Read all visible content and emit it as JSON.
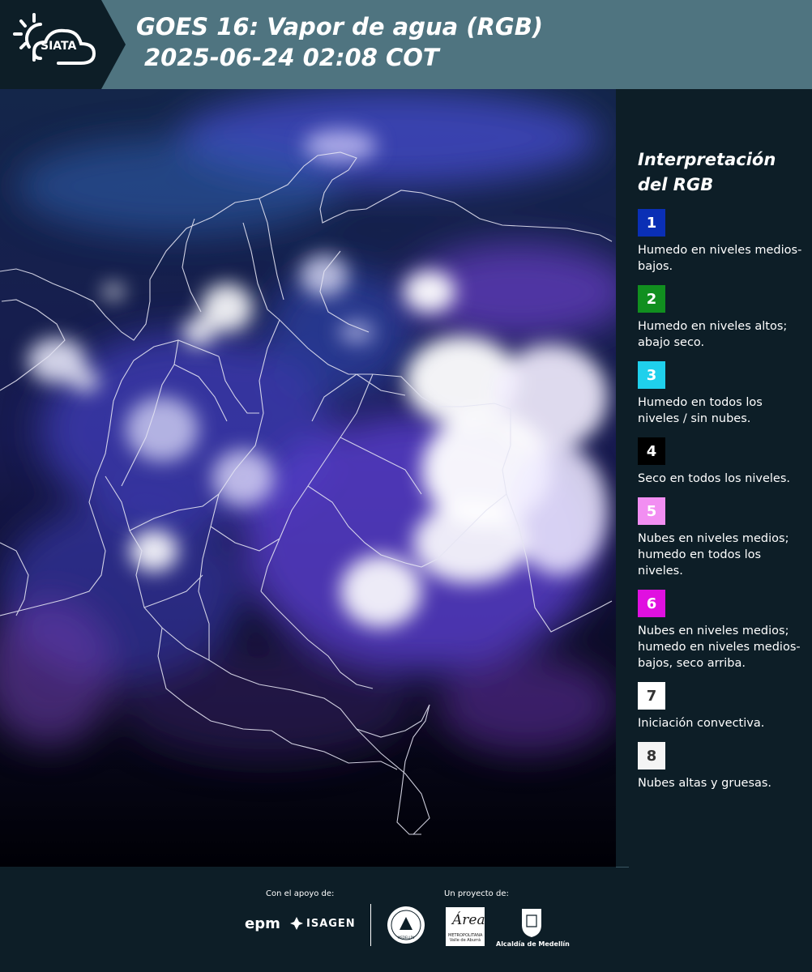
{
  "header": {
    "logo_text": "SIATA",
    "title_line1": "GOES 16: Vapor de agua (RGB)",
    "title_line2": "2025-06-24 02:08 COT"
  },
  "legend": {
    "title_line1": "Interpretación",
    "title_line2": "del RGB",
    "items": [
      {
        "number": "1",
        "color": "#0a2fb5",
        "text_color": "#ffffff",
        "label": "Humedo en niveles medios-bajos."
      },
      {
        "number": "2",
        "color": "#118f1f",
        "text_color": "#ffffff",
        "label": "Humedo en niveles altos; abajo seco."
      },
      {
        "number": "3",
        "color": "#1fd0ec",
        "text_color": "#ffffff",
        "label": "Humedo en todos los niveles / sin nubes."
      },
      {
        "number": "4",
        "color": "#000000",
        "text_color": "#ffffff",
        "label": "Seco en todos los niveles."
      },
      {
        "number": "5",
        "color": "#f28ef2",
        "text_color": "#ffffff",
        "label": "Nubes en niveles medios; humedo en todos los niveles."
      },
      {
        "number": "6",
        "color": "#e010e0",
        "text_color": "#ffffff",
        "label": "Nubes en niveles medios; humedo en niveles medios-bajos, seco arriba."
      },
      {
        "number": "7",
        "color": "#ffffff",
        "text_color": "#333333",
        "label": "Iniciación convectiva."
      },
      {
        "number": "8",
        "color": "#f4f4f4",
        "text_color": "#333333",
        "label": "Nubes altas y gruesas."
      }
    ]
  },
  "footer": {
    "support_label": "Con el apoyo de:",
    "project_label": "Un proyecto de:",
    "epm": "epm",
    "isagen": "ISAGEN",
    "area_word": "Área",
    "area_sub": "METROPOLITANA Valle de Aburrá",
    "alcaldia": "Alcaldía de Medellín",
    "seal_text": "MEDELLÍN"
  }
}
